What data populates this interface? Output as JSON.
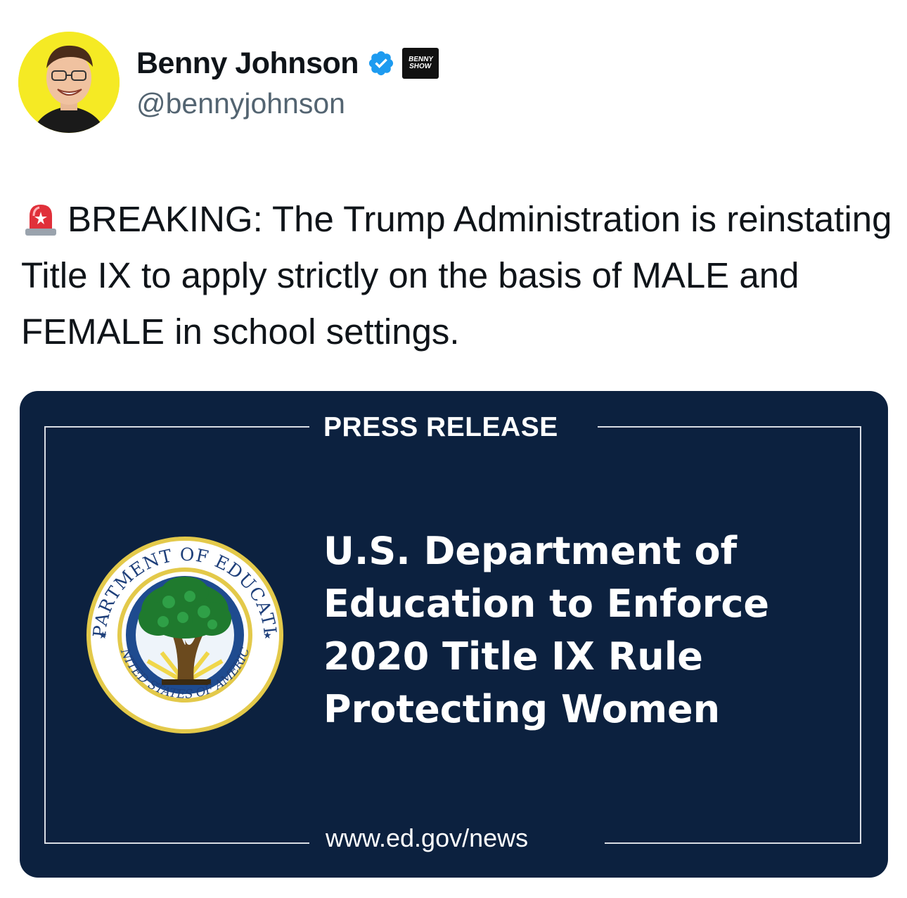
{
  "author": {
    "display_name": "Benny Johnson",
    "handle": "@bennyjohnson",
    "verified_icon": "verified-badge-icon",
    "affiliate_badge_lines": [
      "BENNY",
      "SHOW"
    ]
  },
  "tweet": {
    "emoji": "rotating-light-icon",
    "text": "BREAKING: The Trump Administration is reinstating Title IX to apply strictly on the basis of MALE and FEMALE in school settings."
  },
  "card": {
    "label": "PRESS RELEASE",
    "headline_lines": [
      "U.S. Department of",
      "Education to Enforce",
      "2020 Title IX Rule",
      "Protecting Women"
    ],
    "url": "www.ed.gov/news",
    "seal_top_text": "DEPARTMENT OF EDUCATION",
    "seal_bottom_text": "UNITED STATES OF AMERICA",
    "colors": {
      "background": "#0c213f",
      "frame": "#d9dde4",
      "text": "#ffffff",
      "seal_ring": "#e3c94a",
      "seal_band": "#1e4b8f"
    }
  },
  "colors": {
    "verified": "#1d9bf0",
    "avatar_bg": "#f5ea24",
    "secondary_text": "#536471"
  }
}
